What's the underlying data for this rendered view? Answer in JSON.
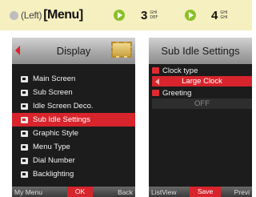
{
  "instruction": {
    "left_label": "(Left)",
    "menu_label": "[Menu]",
    "step1_key": "3",
    "step1_letters": [
      "GHI",
      "DEF"
    ],
    "step2_key": "4",
    "step2_letters": [
      "GHI",
      "GHI"
    ]
  },
  "display_screen": {
    "title": "Display",
    "items": [
      "Main Screen",
      "Sub Screen",
      "Idle Screen Deco.",
      "Sub Idle Settings",
      "Graphic Style",
      "Menu Type",
      "Dial Number",
      "Backlighting"
    ],
    "selected_index": 3,
    "softkeys": {
      "left": "My Menu",
      "center": "OK",
      "right": "Back"
    }
  },
  "sub_idle_screen": {
    "title": "Sub Idle Settings",
    "clock_type_label": "Clock type",
    "clock_type_value": "Large Clock",
    "greeting_label": "Greeting",
    "greeting_value": "OFF",
    "softkeys": {
      "left": "ListView",
      "center": "Save",
      "right": "Previ"
    }
  },
  "colors": {
    "instruction_bg": "#f6efbf",
    "arrow_green": "#8bbf2a",
    "highlight_red": "#d8242c",
    "screen_bg": "#1c1c1c"
  }
}
